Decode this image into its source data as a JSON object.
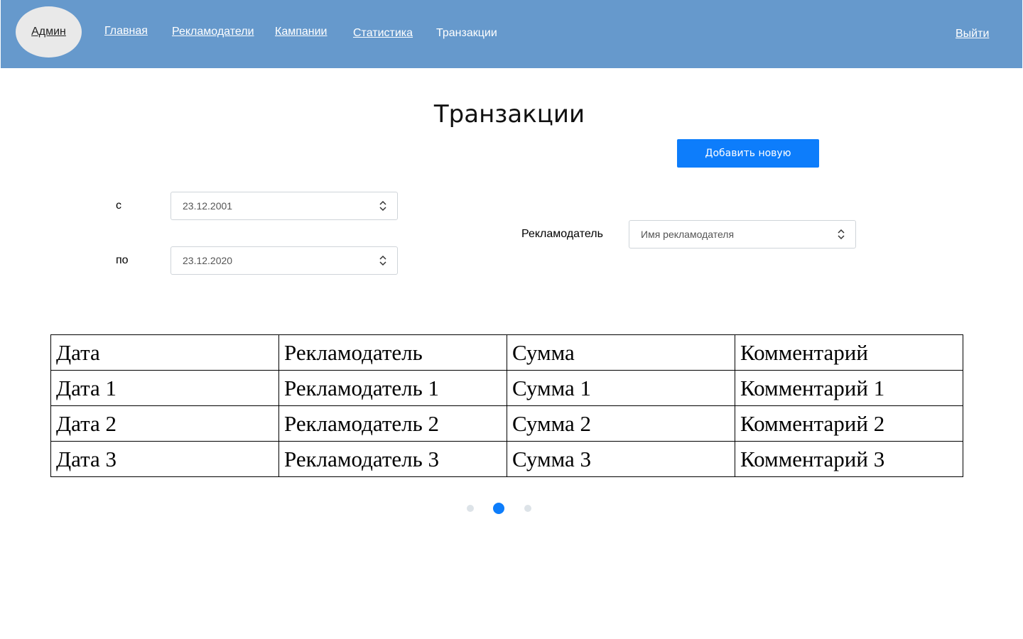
{
  "header": {
    "user_badge": "Админ",
    "nav": [
      {
        "label": "Главная"
      },
      {
        "label": "Рекламодатели"
      },
      {
        "label": "Кампании"
      },
      {
        "label": "Статистика"
      },
      {
        "label": "Транзакции"
      }
    ],
    "logout": "Выйти",
    "background_color": "#6699cc"
  },
  "main": {
    "title": "Транзакции",
    "add_button": "Добавить новую",
    "accent_color": "#0d7dfb"
  },
  "filters": {
    "from_label": "с",
    "from_value": "23.12.2001",
    "to_label": "по",
    "to_value": "23.12.2020",
    "advertiser_label": "Рекламодатель",
    "advertiser_placeholder": "Имя рекламодателя"
  },
  "table": {
    "headers": [
      "Дата",
      "Рекламодатель",
      "Сумма",
      "Комментарий"
    ],
    "rows": [
      [
        "Дата 1",
        "Рекламодатель 1",
        "Сумма 1",
        "Комментарий 1"
      ],
      [
        "Дата 2",
        "Рекламодатель 2",
        "Сумма 2",
        "Комментарий 2"
      ],
      [
        "Дата 3",
        "Рекламодатель 3",
        "Сумма 3",
        "Комментарий 3"
      ]
    ]
  },
  "pagination": {
    "pages": 3,
    "active_page": 2
  }
}
